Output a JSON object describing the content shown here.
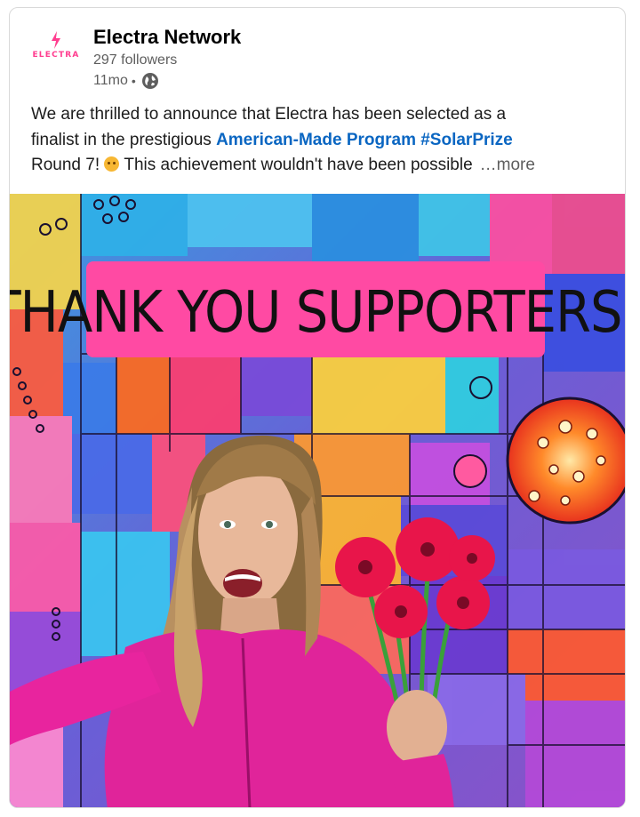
{
  "post": {
    "author": {
      "name": "Electra Network",
      "followers": "297 followers",
      "age": "11mo",
      "separator": "•",
      "visibility_icon": "globe-icon",
      "logo_wordmark": "ELECTRA"
    },
    "text": {
      "line1": "We are thrilled to announce that Electra has been selected as a",
      "line2_prefix": "finalist in the prestigious ",
      "line2_link": "American-Made Program #SolarPrize",
      "line3_a": " Round 7! ",
      "line3_emoji": "smiling-face-emoji",
      "line3_b": " This achievement wouldn't have been possible",
      "more": "…more"
    },
    "image": {
      "banner_text": "THANK YOU SUPPORTERS!",
      "description_icon": "photo"
    }
  },
  "colors": {
    "link": "#0a66c2",
    "brand_pink": "#ff3d8f",
    "banner_pink": "#ff4aa3",
    "muted_text": "#5e5e5e"
  }
}
